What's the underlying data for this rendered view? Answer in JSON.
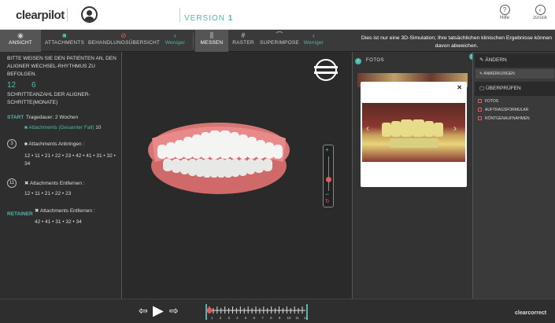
{
  "header": {
    "logo": "clearpilot",
    "version_label": "VERSION",
    "version_number": "1",
    "help_label": "Hilfe",
    "back_label": "zurück"
  },
  "toolbar": {
    "items": [
      {
        "label": "ANSICHT",
        "icon": "eye-icon"
      },
      {
        "label": "ATTACHMENTS",
        "icon": "square-icon"
      },
      {
        "label": "BEHANDLUNGSÜBERSICHT",
        "icon": "tooth-icon"
      },
      {
        "label": "Weniger",
        "icon": "chevron-left-icon"
      },
      {
        "label": "MESSEN",
        "icon": "measure-icon"
      },
      {
        "label": "RASTER",
        "icon": "grid-icon"
      },
      {
        "label": "SUPERIMPOSE",
        "icon": "superimpose-icon"
      },
      {
        "label": "Weniger",
        "icon": "chevron-left-icon"
      }
    ],
    "notice": "Dies ist nur eine 3D-Simulation; Ihre tatsächlichen klinischen Ergebnisse können davon abweichen."
  },
  "left": {
    "instruction": "BITTE WEISEN SIE DEN PATIENTEN AN, DEN ALIGNER WECHSEL-RHYTHMUS ZU BEFOLGEN.",
    "steps": "12",
    "months": "6",
    "steps_label": "SCHRITTEANZAHL DER ALIGNER-SCHRITTE(MONATE)",
    "start_label": "START",
    "wear_time": "Tragedauer: 2 Wochen",
    "attachments_total_label": "Attachments (Gesamter Fall)",
    "attachments_total": "10",
    "stage_a": "3",
    "attach_add_label": "Attachments Anbringen :",
    "attach_add_teeth": "12 • 11 • 21 • 22 • 23 • 42 • 41 • 31 • 32 • 34",
    "stage_b": "11",
    "attach_remove_label": "Attachments Entfernen :",
    "attach_remove_teeth": "12 • 11 • 21 • 22 • 23",
    "retainer_label": "RETAINER",
    "retainer_remove_label": "Attachments Entfernen :",
    "retainer_remove_teeth": "42 • 41 • 31 • 32 • 34"
  },
  "photos": {
    "title": "FOTOS"
  },
  "right": {
    "change_label": "ÄNDERN",
    "notes_label": "ANMERKUNGEN",
    "review_label": "ÜBERPRÜFEN",
    "checks": [
      "FOTOS",
      "AUFTRAGSFORMULAR",
      "RÖNTGENAUFNAHMEN"
    ]
  },
  "timeline": {
    "ticks": [
      "1",
      "2",
      "3",
      "4",
      "5",
      "6",
      "7",
      "8",
      "9",
      "10",
      "11",
      "12"
    ],
    "brand": "clearcorrect"
  },
  "colors": {
    "accent": "#4fb8ac",
    "alert": "#e05a5a"
  }
}
